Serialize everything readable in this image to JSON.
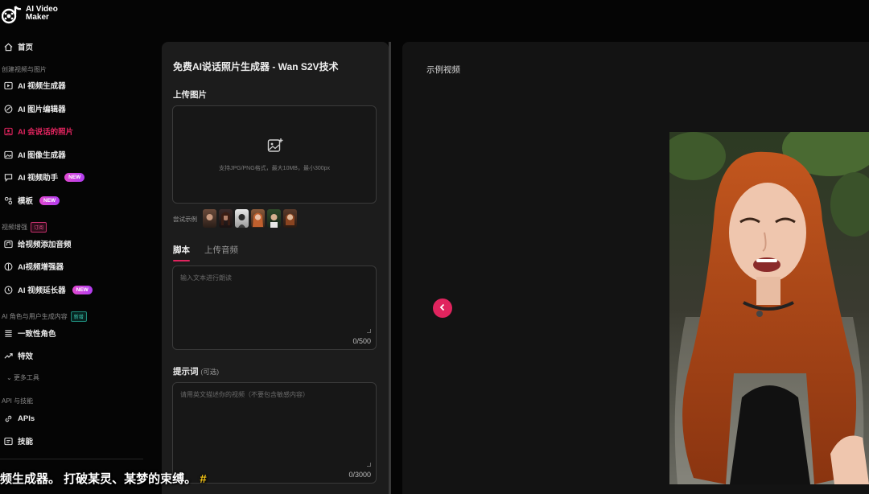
{
  "app": {
    "logo_line1": "AI Video",
    "logo_line2": "Maker"
  },
  "sidebar": {
    "home": "首页",
    "section_create": "创建视频与图片",
    "create_items": [
      {
        "label": "AI 视频生成器",
        "icon": "video-icon"
      },
      {
        "label": "AI 图片编辑器",
        "icon": "image-edit-icon"
      },
      {
        "label": "AI 会说话的照片",
        "icon": "talking-photo-icon",
        "active": true
      },
      {
        "label": "AI 图像生成器",
        "icon": "image-icon"
      },
      {
        "label": "AI 视频助手",
        "icon": "chat-icon",
        "badge": "NEW"
      },
      {
        "label": "模板",
        "icon": "template-icon",
        "badge": "NEW"
      }
    ],
    "section_enhance": "视频增强",
    "section_enhance_badge": "订阅",
    "enhance_items": [
      {
        "label": "给视频添加音频",
        "icon": "audio-add-icon"
      },
      {
        "label": "AI视频增强器",
        "icon": "enhance-icon"
      },
      {
        "label": "AI 视频延长器",
        "icon": "extend-icon",
        "badge": "NEW"
      }
    ],
    "section_ugc": "AI 角色与用户生成内容",
    "section_ugc_badge": "新增",
    "ugc_items": [
      {
        "label": "一致性角色",
        "icon": "grid-icon"
      },
      {
        "label": "特效",
        "icon": "trend-icon"
      }
    ],
    "more_tools": "更多工具",
    "section_api": "API 与技能",
    "api_items": [
      {
        "label": "APIs",
        "icon": "link-icon"
      },
      {
        "label": "技能",
        "icon": "skill-icon"
      }
    ]
  },
  "form": {
    "title": "免费AI说话照片生成器 - Wan S2V技术",
    "upload_label": "上传图片",
    "upload_hint": "支持JPG/PNG格式，最大10MB，最小300px",
    "try_label": "尝试示例",
    "tabs": [
      "脚本",
      "上传音频"
    ],
    "script_placeholder": "输入文本进行朗读",
    "script_count": "0/500",
    "prompt_label": "提示词",
    "prompt_optional": "(可选)",
    "prompt_placeholder": "请用英文描述你的视频（不要包含敏感内容）",
    "prompt_count": "0/3000"
  },
  "preview": {
    "title": "示例视频"
  },
  "subtitle": {
    "text": "频生成器。 打破某灵、某梦的束缚。",
    "hash": "#"
  },
  "colors": {
    "accent": "#e0245e",
    "panel": "#1c1c1c",
    "preview": "#131313"
  }
}
